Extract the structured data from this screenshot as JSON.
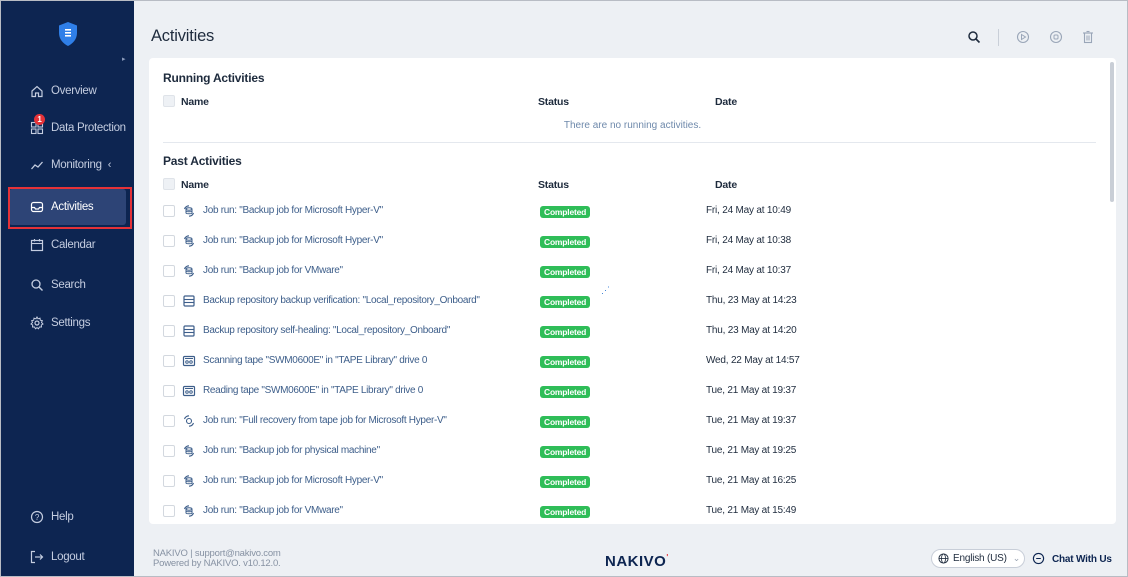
{
  "app": {
    "title": "Activities"
  },
  "sidebar": {
    "items": [
      {
        "label": "Overview",
        "icon": "home-icon"
      },
      {
        "label": "Data Protection",
        "icon": "grid-icon",
        "badge": "1"
      },
      {
        "label": "Monitoring",
        "icon": "chart-line-icon"
      },
      {
        "label": "Activities",
        "icon": "inbox-icon",
        "active": true
      },
      {
        "label": "Calendar",
        "icon": "calendar-icon"
      },
      {
        "label": "Search",
        "icon": "search-icon"
      },
      {
        "label": "Settings",
        "icon": "gear-icon"
      }
    ],
    "help_label": "Help",
    "logout_label": "Logout"
  },
  "running": {
    "title": "Running Activities",
    "columns": {
      "name": "Name",
      "status": "Status",
      "date": "Date"
    },
    "empty_message": "There are no running activities."
  },
  "past": {
    "title": "Past Activities",
    "columns": {
      "name": "Name",
      "status": "Status",
      "date": "Date"
    },
    "rows": [
      {
        "icon": "job-icon",
        "name": "Job run: \"Backup job for Microsoft Hyper-V\"",
        "status": "Completed",
        "date": "Fri, 24 May at 10:49"
      },
      {
        "icon": "job-icon",
        "name": "Job run: \"Backup job for Microsoft Hyper-V\"",
        "status": "Completed",
        "date": "Fri, 24 May at 10:38"
      },
      {
        "icon": "job-icon",
        "name": "Job run: \"Backup job for VMware\"",
        "status": "Completed",
        "date": "Fri, 24 May at 10:37"
      },
      {
        "icon": "repository-icon",
        "name": "Backup repository backup verification: \"Local_repository_Onboard\"",
        "status": "Completed",
        "date": "Thu, 23 May at 14:23"
      },
      {
        "icon": "repository-icon",
        "name": "Backup repository self-healing: \"Local_repository_Onboard\"",
        "status": "Completed",
        "date": "Thu, 23 May at 14:20"
      },
      {
        "icon": "tape-icon",
        "name": "Scanning tape \"SWM0600E\" in \"TAPE Library\" drive 0",
        "status": "Completed",
        "date": "Wed, 22 May at 14:57"
      },
      {
        "icon": "tape-icon",
        "name": "Reading tape \"SWM0600E\" in \"TAPE Library\" drive 0",
        "status": "Completed",
        "date": "Tue, 21 May at 19:37"
      },
      {
        "icon": "recovery-icon",
        "name": "Job run: \"Full recovery from tape job for Microsoft Hyper-V\"",
        "status": "Completed",
        "date": "Tue, 21 May at 19:37"
      },
      {
        "icon": "job-icon",
        "name": "Job run: \"Backup job for physical machine\"",
        "status": "Completed",
        "date": "Tue, 21 May at 19:25"
      },
      {
        "icon": "job-icon",
        "name": "Job run: \"Backup job for Microsoft Hyper-V\"",
        "status": "Completed",
        "date": "Tue, 21 May at 16:25"
      },
      {
        "icon": "job-icon",
        "name": "Job run: \"Backup job for VMware\"",
        "status": "Completed",
        "date": "Tue, 21 May at 15:49"
      }
    ]
  },
  "footer": {
    "contact": "NAKIVO | support@nakivo.com",
    "powered_by": "Powered by NAKIVO. v10.12.0.",
    "brand": "NAKIVO",
    "brand_mark": "'",
    "language": "English (US)",
    "chat_label": "Chat With Us"
  },
  "colors": {
    "sidebar_bg": "#0d2551",
    "active_item_bg": "#2d4476",
    "status_completed": "#2fbd58",
    "highlight_outline": "#e53238",
    "link_text": "#3d5e8a"
  }
}
